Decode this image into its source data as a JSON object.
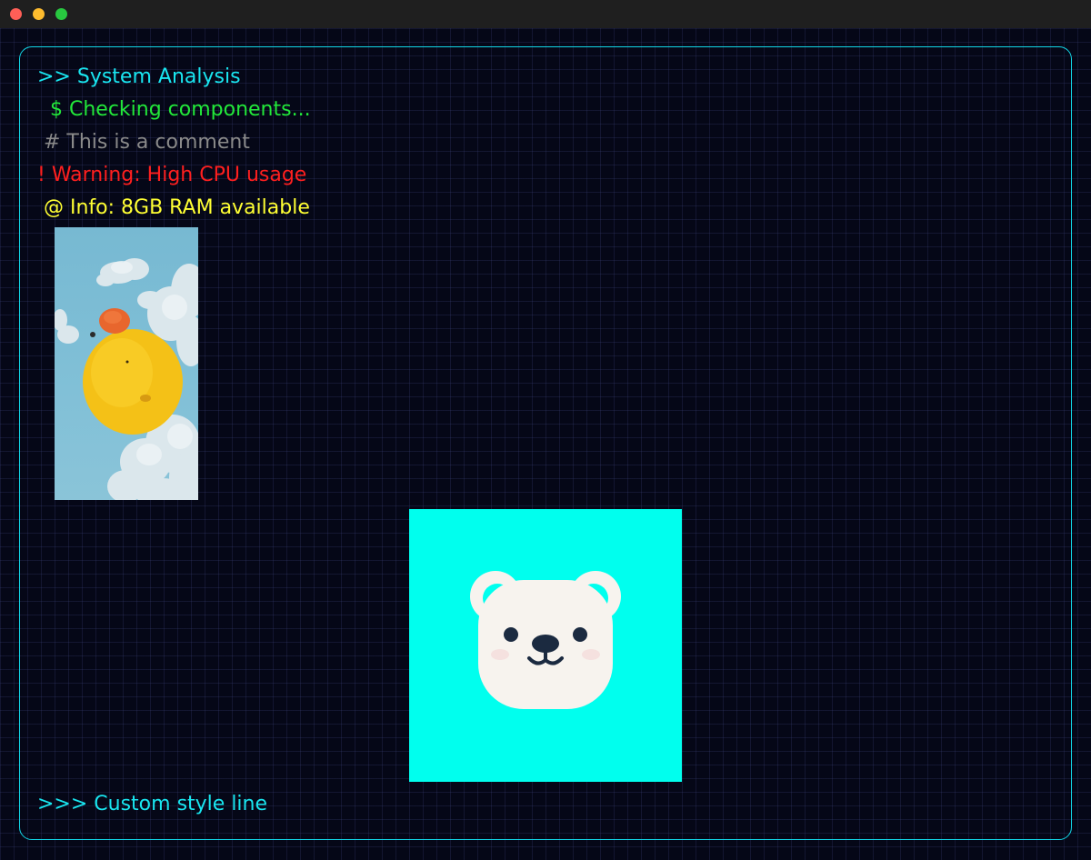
{
  "window": {
    "controls": [
      "close",
      "minimize",
      "maximize"
    ]
  },
  "terminal": {
    "lines": [
      {
        "text": ">> System Analysis",
        "color": "#19e6f0"
      },
      {
        "text": "  $ Checking components...",
        "color": "#22e83a"
      },
      {
        "text": " # This is a comment",
        "color": "#8a8a8a"
      },
      {
        "text": "! Warning: High CPU usage",
        "color": "#ff1f1f"
      },
      {
        "text": " @ Info: 8GB RAM available",
        "color": "#ffff33"
      },
      {
        "text": ">>> Custom style line",
        "color": "#19e6f0"
      }
    ],
    "border_color": "#12d6e6",
    "background": "#050717"
  },
  "images": {
    "duck": {
      "subject": "yellow rubber duck among clouds"
    },
    "bear": {
      "subject": "white bear face icon",
      "background": "#00ffee"
    }
  }
}
